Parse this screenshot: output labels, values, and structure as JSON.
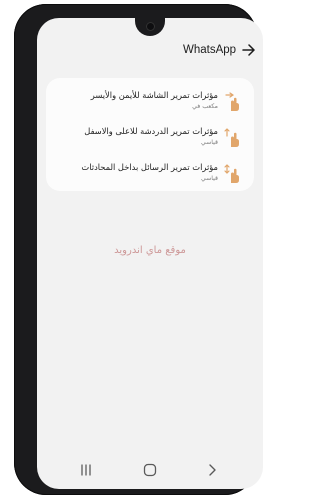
{
  "appbar": {
    "title": "WhatsApp",
    "back_icon": "arrow-right-icon"
  },
  "settings": [
    {
      "title": "مؤثرات تمرير الشاشة للأيمن والأيسر",
      "subtitle": "مكعب في",
      "icon": "hand-swipe-horizontal-icon"
    },
    {
      "title": "مؤثرات تمرير الدردشة للاعلى والاسفل",
      "subtitle": "قياسي",
      "icon": "hand-swipe-vertical-icon"
    },
    {
      "title": "مؤثرات تمرير الرسائل بداخل المحادثات",
      "subtitle": "قياسي",
      "icon": "hand-scroll-icon"
    }
  ],
  "watermark": "موقع ماي اندرويد",
  "navbar": {
    "recent_icon": "recent-apps-icon",
    "home_icon": "home-icon",
    "back_icon": "back-chevron-icon"
  },
  "colors": {
    "screen_bg": "#f2f2f2",
    "card_bg": "#fcfcfc",
    "icon_accent": "#e1a66b",
    "watermark": "#c98e8e"
  }
}
